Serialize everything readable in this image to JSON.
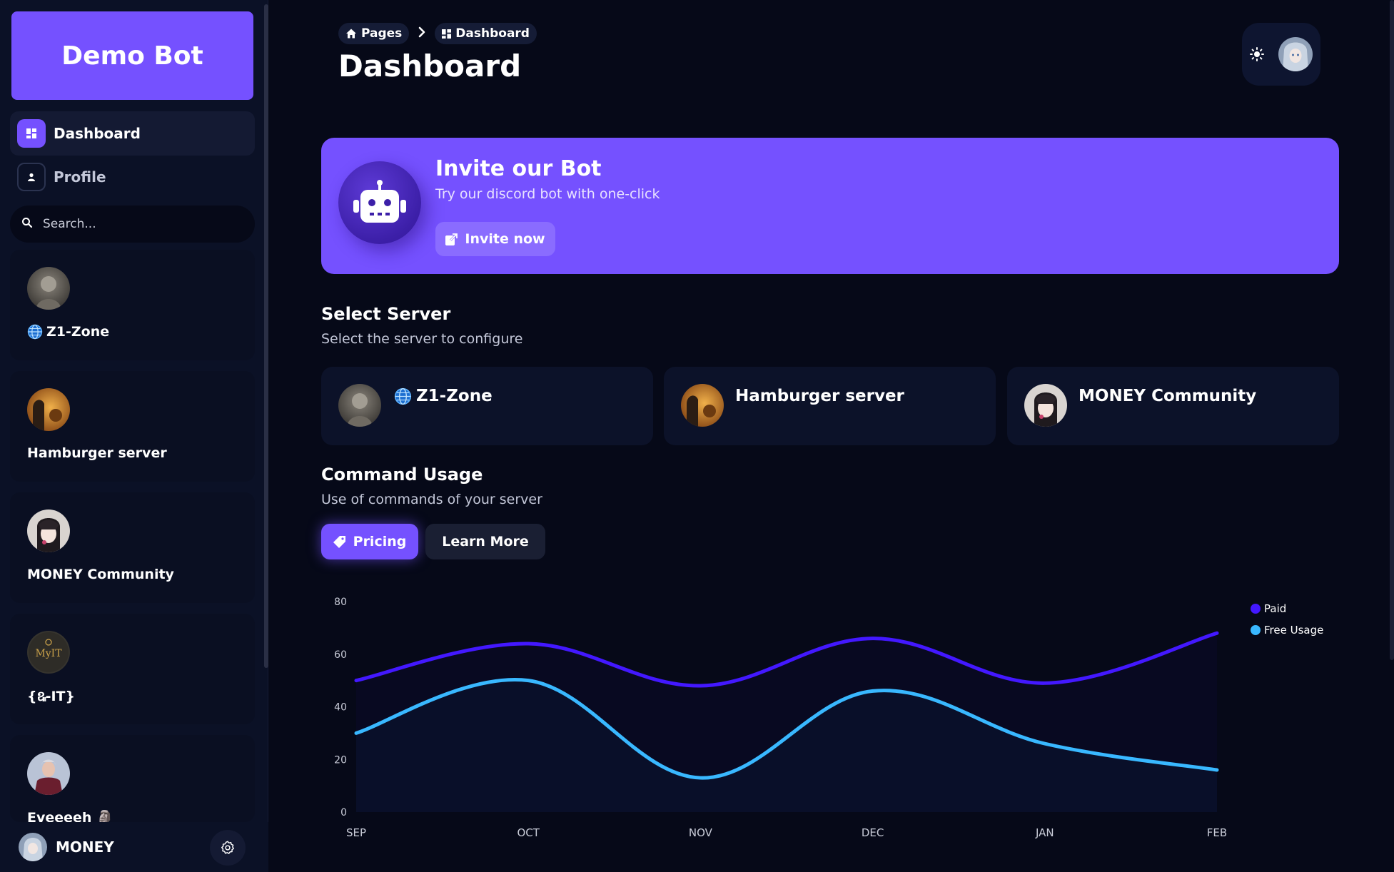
{
  "sidebar": {
    "brand": "Demo Bot",
    "nav": [
      {
        "label": "Dashboard",
        "icon": "dashboard-icon",
        "active": true
      },
      {
        "label": "Profile",
        "icon": "user-icon",
        "active": false
      }
    ],
    "search": {
      "placeholder": "Search..."
    },
    "servers": [
      {
        "name": "Z1-Zone",
        "icon": "globe-icon"
      },
      {
        "name": "Hamburger server"
      },
      {
        "name": "MONEY Community"
      },
      {
        "name": "{ឩ-IT}"
      },
      {
        "name": "Eveeeeh 🗿"
      }
    ],
    "user": {
      "name": "MONEY"
    }
  },
  "header": {
    "breadcrumb": [
      {
        "label": "Pages",
        "icon": "home-icon"
      },
      {
        "label": "Dashboard",
        "icon": "dashboard-icon"
      }
    ],
    "title": "Dashboard"
  },
  "banner": {
    "title": "Invite our Bot",
    "subtitle": "Try our discord bot with one-click",
    "button": "Invite now",
    "icon": "robot-icon"
  },
  "select_server": {
    "title": "Select Server",
    "subtitle": "Select the server to configure",
    "servers": [
      {
        "name": "Z1-Zone",
        "icon": "globe-icon"
      },
      {
        "name": "Hamburger server"
      },
      {
        "name": "MONEY Community"
      }
    ]
  },
  "command_usage": {
    "title": "Command Usage",
    "subtitle": "Use of commands of your server",
    "pricing_button": "Pricing",
    "learn_more_button": "Learn More"
  },
  "colors": {
    "accent": "#7551ff",
    "paid": "#4318ff",
    "free": "#39b8ff",
    "background": "#060918"
  },
  "chart_data": {
    "type": "line",
    "categories": [
      "SEP",
      "OCT",
      "NOV",
      "DEC",
      "JAN",
      "FEB"
    ],
    "series": [
      {
        "name": "Paid",
        "values": [
          50,
          64,
          48,
          66,
          49,
          68
        ]
      },
      {
        "name": "Free Usage",
        "values": [
          30,
          50,
          13,
          46,
          26,
          16
        ]
      }
    ],
    "yticks": [
      "0",
      "20",
      "40",
      "60",
      "80"
    ],
    "ylim": [
      0,
      80
    ],
    "grid": false,
    "legend": "top-right"
  }
}
